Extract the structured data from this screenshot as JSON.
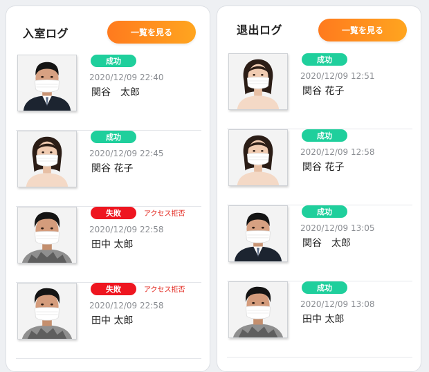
{
  "entry_log": {
    "title": "入室ログ",
    "view_all_label": "一覧を見る",
    "items": [
      {
        "status": "成功",
        "status_type": "success",
        "reason": "",
        "time": "2020/12/09  22:40",
        "name": "関谷　太郎",
        "photo_icon": "man-masked-suit-photo"
      },
      {
        "status": "成功",
        "status_type": "success",
        "reason": "",
        "time": "2020/12/09  22:45",
        "name": "関谷 花子",
        "photo_icon": "woman-masked-photo"
      },
      {
        "status": "失敗",
        "status_type": "fail",
        "reason": "アクセス拒否",
        "time": "2020/12/09  22:58",
        "name": "田中 太郎",
        "photo_icon": "man-masked-casual-photo"
      },
      {
        "status": "失敗",
        "status_type": "fail",
        "reason": "アクセス拒否",
        "time": "2020/12/09  22:58",
        "name": "田中 太郎",
        "photo_icon": "man-masked-casual-photo"
      }
    ]
  },
  "exit_log": {
    "title": "退出ログ",
    "view_all_label": "一覧を見る",
    "items": [
      {
        "status": "成功",
        "status_type": "success",
        "reason": "",
        "time": "2020/12/09  12:51",
        "name": "関谷 花子",
        "photo_icon": "woman-masked-photo"
      },
      {
        "status": "成功",
        "status_type": "success",
        "reason": "",
        "time": "2020/12/09  12:58",
        "name": "関谷 花子",
        "photo_icon": "woman-masked-photo"
      },
      {
        "status": "成功",
        "status_type": "success",
        "reason": "",
        "time": "2020/12/09  13:05",
        "name": "関谷　太郎",
        "photo_icon": "man-masked-suit-photo"
      },
      {
        "status": "成功",
        "status_type": "success",
        "reason": "",
        "time": "2020/12/09  13:08",
        "name": "田中 太郎",
        "photo_icon": "man-masked-casual-photo"
      }
    ]
  },
  "colors": {
    "success": "#1fcf9c",
    "fail": "#ee1620",
    "button_gradient_start": "#ff7a1e",
    "button_gradient_end": "#ffa51f"
  }
}
